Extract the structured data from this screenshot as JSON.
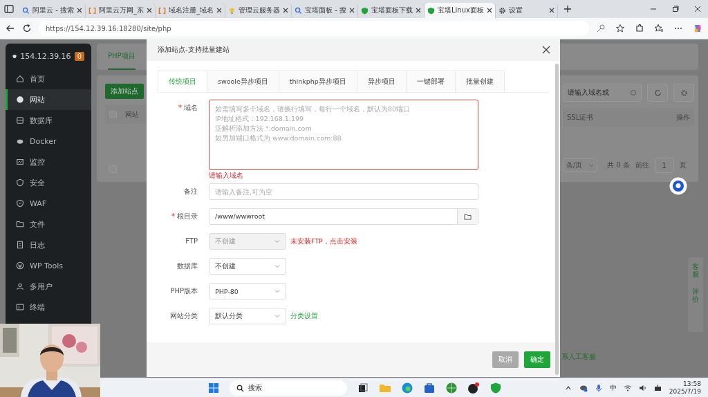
{
  "browser": {
    "tabs": [
      {
        "kind": "search",
        "title": "阿里云 - 搜索",
        "selected": false
      },
      {
        "kind": "bracket",
        "title": "阿里云万网_东",
        "selected": false
      },
      {
        "kind": "bracket",
        "title": "域名注册_域名",
        "selected": false
      },
      {
        "kind": "bulb",
        "title": "管理云服务器",
        "selected": false
      },
      {
        "kind": "search",
        "title": "宝塔面板 - 搜",
        "selected": false
      },
      {
        "kind": "shield",
        "title": "宝塔面板下载",
        "selected": false
      },
      {
        "kind": "shield",
        "title": "宝塔Linux面板",
        "selected": true
      },
      {
        "kind": "gear",
        "title": "设置",
        "selected": false
      }
    ],
    "address": "https://154.12.39.16:18280/site/php"
  },
  "sidebar": {
    "host": "154.12.39.16",
    "badge": "0",
    "items": [
      {
        "label": "首页",
        "selected": false
      },
      {
        "label": "网站",
        "selected": true
      },
      {
        "label": "数据库",
        "selected": false
      },
      {
        "label": "Docker",
        "selected": false
      },
      {
        "label": "监控",
        "selected": false
      },
      {
        "label": "安全",
        "selected": false
      },
      {
        "label": "WAF",
        "selected": false
      },
      {
        "label": "文件",
        "selected": false
      },
      {
        "label": "日志",
        "selected": false
      },
      {
        "label": "WP Tools",
        "selected": false
      },
      {
        "label": "多用户",
        "selected": false
      },
      {
        "label": "终端",
        "selected": false
      }
    ]
  },
  "page": {
    "tab": "PHP项目",
    "add_button": "添加站点",
    "header_checkbox": {
      "checked": false
    },
    "column_1": "网站",
    "footer_checkbox": {
      "checked": false
    },
    "search_placeholder": "请输入域名或",
    "columns": [
      "SSL证书",
      "操作"
    ],
    "per_page": "条/页",
    "total": "共 0 条",
    "goto": "前往",
    "page_number": "1",
    "page_unit": "页",
    "side_buttons": [
      "客服",
      "评价"
    ],
    "support_link": "系人工客服"
  },
  "dialog": {
    "title": "添加站点-支持批量建站",
    "tabs": [
      {
        "label": "传统项目",
        "selected": true
      },
      {
        "label": "swoole异步项目",
        "selected": false
      },
      {
        "label": "thinkphp异步项目",
        "selected": false
      },
      {
        "label": "异步项目",
        "selected": false
      },
      {
        "label": "一键部署",
        "selected": false
      },
      {
        "label": "批量创建",
        "selected": false
      }
    ],
    "fields": [
      {
        "kind": "textarea",
        "mark": "*",
        "label": "域名",
        "placeholder": "如需填写多个域名，请换行填写，每行一个域名，默认为80端口\nIP地址格式：192.168.1.199\n泛解析添加方法 *.domain.com\n如另加端口格式为 www.domain.com:88",
        "error": "请输入域名"
      },
      {
        "kind": "input",
        "label": "备注",
        "placeholder": "请输入备注,可为空"
      },
      {
        "kind": "path",
        "mark": "*",
        "label": "根目录",
        "value": "/www/wwwroot"
      },
      {
        "kind": "select",
        "label": "FTP",
        "value": "不创建",
        "disabled": true,
        "note": {
          "text": "未安装FTP，点击安装",
          "kind": "warning"
        }
      },
      {
        "kind": "select",
        "label": "数据库",
        "value": "不创建",
        "disabled": false
      },
      {
        "kind": "select",
        "label": "PHP版本",
        "value": "PHP-80",
        "disabled": false
      },
      {
        "kind": "select",
        "label": "网站分类",
        "value": "默认分类",
        "disabled": false,
        "note": {
          "text": "分类设置",
          "kind": "link"
        }
      }
    ],
    "buttons": [
      {
        "label": "取消",
        "kind": "cancel"
      },
      {
        "label": "确定",
        "kind": "confirm"
      }
    ]
  },
  "taskbar": {
    "search": "搜索",
    "ime": "中",
    "time": "13:58",
    "date": "2025/7/19"
  }
}
